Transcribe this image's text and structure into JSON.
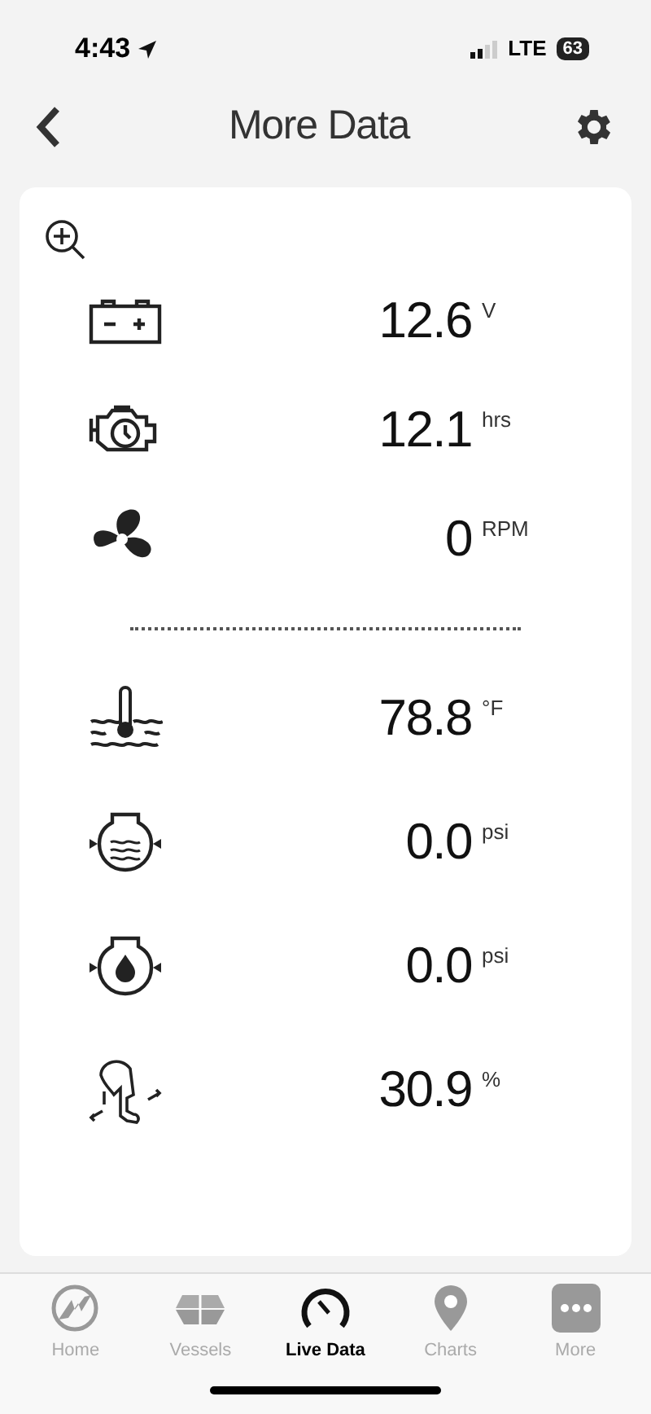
{
  "status_bar": {
    "time": "4:43",
    "network": "LTE",
    "battery": "63"
  },
  "header": {
    "title": "More Data"
  },
  "groups": [
    {
      "readings": [
        {
          "kind": "battery",
          "value": "12.6",
          "unit": "V"
        },
        {
          "kind": "engine-hours",
          "value": "12.1",
          "unit": "hrs"
        },
        {
          "kind": "propeller",
          "value": "0",
          "unit": "RPM"
        }
      ]
    },
    {
      "readings": [
        {
          "kind": "water-temp",
          "value": "78.8",
          "unit": "°F"
        },
        {
          "kind": "water-pressure",
          "value": "0.0",
          "unit": "psi"
        },
        {
          "kind": "oil-pressure",
          "value": "0.0",
          "unit": "psi"
        },
        {
          "kind": "trim",
          "value": "30.9",
          "unit": "%"
        }
      ]
    }
  ],
  "tabs": [
    {
      "kind": "home",
      "label": "Home",
      "selected": false
    },
    {
      "kind": "vessels",
      "label": "Vessels",
      "selected": false
    },
    {
      "kind": "live",
      "label": "Live Data",
      "selected": true
    },
    {
      "kind": "charts",
      "label": "Charts",
      "selected": false
    },
    {
      "kind": "more",
      "label": "More",
      "selected": false
    }
  ]
}
